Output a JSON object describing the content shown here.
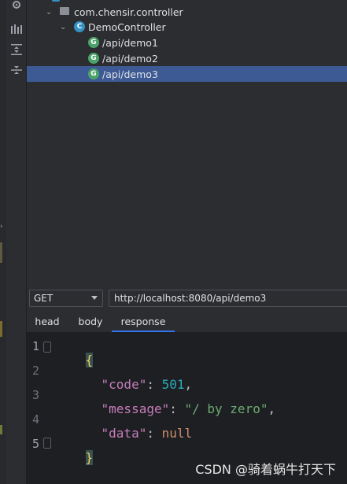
{
  "project_tree": {
    "package_label": "com.chensir.controller",
    "class_label": "DemoController",
    "class_icon": "C",
    "endpoints": [
      {
        "icon": "G",
        "path": "/api/demo1",
        "selected": false
      },
      {
        "icon": "G",
        "path": "/api/demo2",
        "selected": false
      },
      {
        "icon": "G",
        "path": "/api/demo3",
        "selected": true
      }
    ]
  },
  "request": {
    "method": "GET",
    "url": "http://localhost:8080/api/demo3"
  },
  "tabs": [
    {
      "label": "head",
      "active": false
    },
    {
      "label": "body",
      "active": false
    },
    {
      "label": "response",
      "active": true
    }
  ],
  "response": {
    "line_numbers": [
      "1",
      "2",
      "3",
      "4",
      "5"
    ],
    "open_brace": "{",
    "close_brace": "}",
    "fields": [
      {
        "key": "\"code\"",
        "value": "501",
        "type": "number",
        "comma": ","
      },
      {
        "key": "\"message\"",
        "value": "\"/ by zero\"",
        "type": "string",
        "comma": ","
      },
      {
        "key": "\"data\"",
        "value": "null",
        "type": "keyword",
        "comma": ""
      }
    ],
    "colon": ": "
  },
  "watermark": "CSDN @骑着蜗牛打天下",
  "colors": {
    "selection": "#3d5a95",
    "accent": "#3574f0",
    "json_key": "#c77dbb",
    "json_string": "#6aab73",
    "json_number": "#2aacb8",
    "json_keyword": "#cf8e6d"
  }
}
